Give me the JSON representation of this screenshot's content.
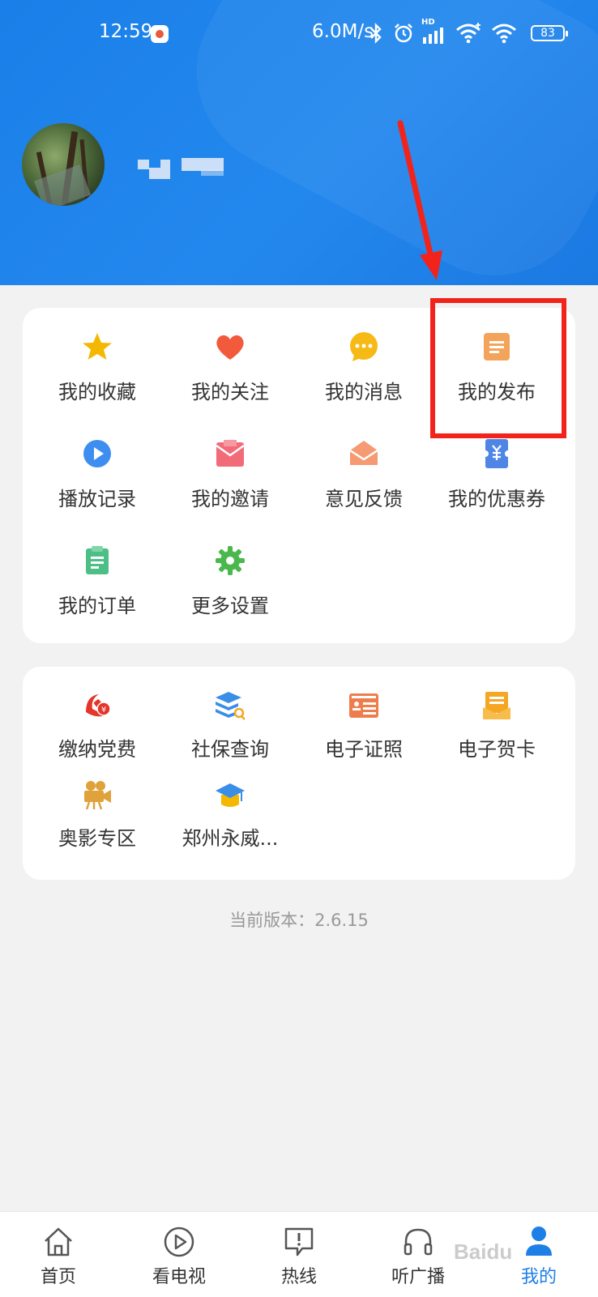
{
  "status_bar": {
    "time": "12:59",
    "net_speed": "6.0M/s",
    "signal_label": "HD",
    "battery": "83"
  },
  "arrow_color": "#f2231a",
  "menu_primary": [
    {
      "label": "我的收藏",
      "icon": "star-icon",
      "color": "#f5b800"
    },
    {
      "label": "我的关注",
      "icon": "heart-icon",
      "color": "#f25a3c"
    },
    {
      "label": "我的消息",
      "icon": "chat-bubble-icon",
      "color": "#f7b913"
    },
    {
      "label": "我的发布",
      "icon": "document-icon",
      "color": "#f3a35a"
    },
    {
      "label": "播放记录",
      "icon": "play-circle-icon",
      "color": "#3d8ef0"
    },
    {
      "label": "我的邀请",
      "icon": "invitation-icon",
      "color": "#f26b78"
    },
    {
      "label": "意见反馈",
      "icon": "envelope-icon",
      "color": "#f59a72"
    },
    {
      "label": "我的优惠券",
      "icon": "coupon-icon",
      "color": "#4f86e6"
    },
    {
      "label": "我的订单",
      "icon": "clipboard-icon",
      "color": "#4dbf86"
    },
    {
      "label": "更多设置",
      "icon": "gear-icon",
      "color": "#4ab84c"
    }
  ],
  "menu_services": [
    {
      "label": "缴纳党费",
      "icon": "party-fee-icon",
      "color": "#e5352b"
    },
    {
      "label": "社保查询",
      "icon": "social-security-icon",
      "color": "#3a8ee6"
    },
    {
      "label": "电子证照",
      "icon": "id-card-icon",
      "color": "#ef7d4c"
    },
    {
      "label": "电子贺卡",
      "icon": "greeting-card-icon",
      "color": "#f5a623"
    },
    {
      "label": "奥影专区",
      "icon": "movie-camera-icon",
      "color": "#e0a23a"
    },
    {
      "label": "郑州永威...",
      "icon": "graduation-cap-icon",
      "color": "#f5b800"
    }
  ],
  "version_text": "当前版本：2.6.15",
  "bottom_nav": [
    {
      "label": "首页",
      "icon": "home-icon",
      "active": false
    },
    {
      "label": "看电视",
      "icon": "tv-play-icon",
      "active": false
    },
    {
      "label": "热线",
      "icon": "hotline-icon",
      "active": false
    },
    {
      "label": "听广播",
      "icon": "headphones-icon",
      "active": false
    },
    {
      "label": "我的",
      "icon": "profile-icon",
      "active": true
    }
  ],
  "watermark": "Baidu"
}
